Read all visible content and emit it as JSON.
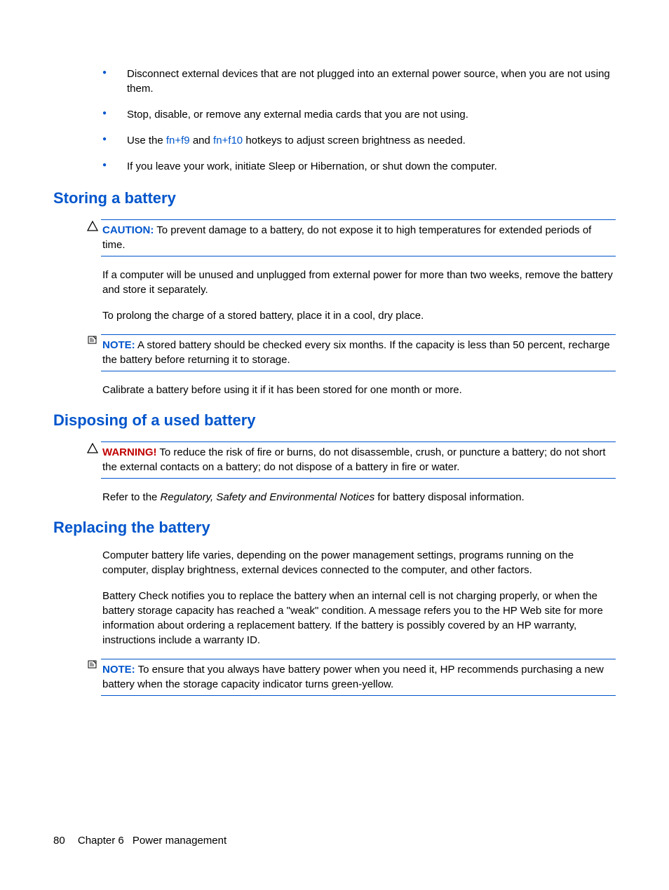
{
  "bullets": {
    "b1": "Disconnect external devices that are not plugged into an external power source, when you are not using them.",
    "b2": "Stop, disable, or remove any external media cards that you are not using.",
    "b3a": "Use the ",
    "b3_hk1": "fn+f9",
    "b3b": " and ",
    "b3_hk2": "fn+f10",
    "b3c": " hotkeys to adjust screen brightness as needed.",
    "b4": "If you leave your work, initiate Sleep or Hibernation, or shut down the computer."
  },
  "sec1": {
    "heading": "Storing a battery",
    "caution_label": "CAUTION:",
    "caution_text": "To prevent damage to a battery, do not expose it to high temperatures for extended periods of time.",
    "p1": "If a computer will be unused and unplugged from external power for more than two weeks, remove the battery and store it separately.",
    "p2": "To prolong the charge of a stored battery, place it in a cool, dry place.",
    "note_label": "NOTE:",
    "note_text": "A stored battery should be checked every six months. If the capacity is less than 50 percent, recharge the battery before returning it to storage.",
    "p3": "Calibrate a battery before using it if it has been stored for one month or more."
  },
  "sec2": {
    "heading": "Disposing of a used battery",
    "warn_label": "WARNING!",
    "warn_text": "To reduce the risk of fire or burns, do not disassemble, crush, or puncture a battery; do not short the external contacts on a battery; do not dispose of a battery in fire or water.",
    "p1a": "Refer to the ",
    "p1i": "Regulatory, Safety and Environmental Notices",
    "p1b": " for battery disposal information."
  },
  "sec3": {
    "heading": "Replacing the battery",
    "p1": "Computer battery life varies, depending on the power management settings, programs running on the computer, display brightness, external devices connected to the computer, and other factors.",
    "p2": "Battery Check notifies you to replace the battery when an internal cell is not charging properly, or when the battery storage capacity has reached a \"weak\" condition. A message refers you to the HP Web site for more information about ordering a replacement battery. If the battery is possibly covered by an HP warranty, instructions include a warranty ID.",
    "note_label": "NOTE:",
    "note_text": "To ensure that you always have battery power when you need it, HP recommends purchasing a new battery when the storage capacity indicator turns green-yellow."
  },
  "footer": {
    "page": "80",
    "chapter": "Chapter 6",
    "title": "Power management"
  }
}
